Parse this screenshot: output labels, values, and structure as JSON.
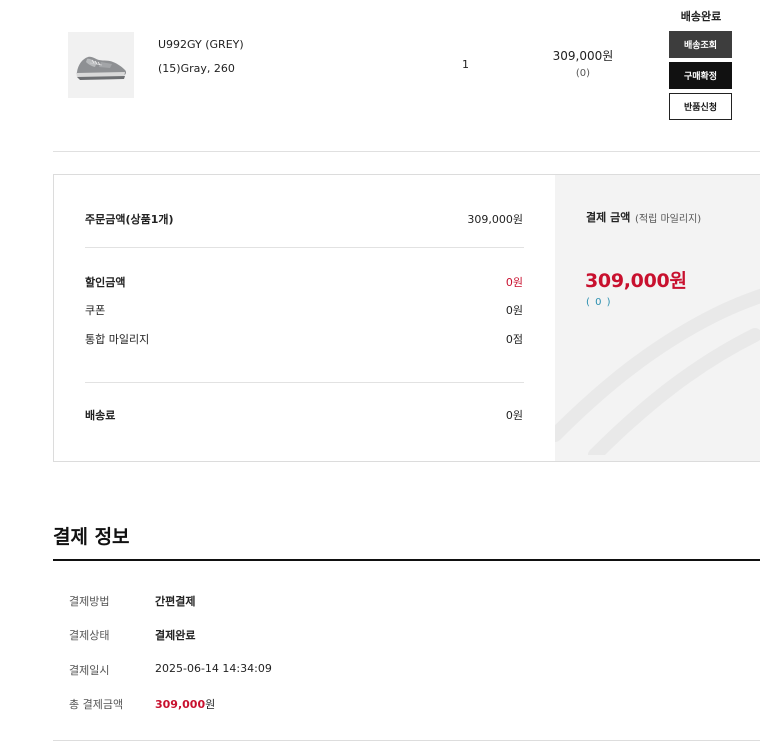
{
  "product": {
    "name": "U992GY (GREY)",
    "option": "(15)Gray, 260",
    "quantity": "1",
    "price": "309,000원",
    "point": "(0)",
    "image_icon": "sneaker-icon"
  },
  "shipping": {
    "status": "배송완료",
    "track_label": "배송조회",
    "confirm_label": "구매확정",
    "return_label": "반품신청"
  },
  "summary": {
    "order_amount_label": "주문금액(상품1개)",
    "order_amount_value": "309,000원",
    "discount_label": "할인금액",
    "discount_value": "0원",
    "coupon_label": "쿠폰",
    "coupon_value": "0원",
    "mileage_label": "통합 마일리지",
    "mileage_value": "0점",
    "delivery_label": "배송료",
    "delivery_value": "0원"
  },
  "payment_summary": {
    "title": "결제 금액",
    "subtitle": "(적립 마일리지)",
    "amount": "309,000원",
    "points": "( 0 )"
  },
  "payment_info": {
    "title": "결제 정보",
    "rows": [
      {
        "label": "결제방법",
        "value": "간편결제"
      },
      {
        "label": "결제상태",
        "value": "결제완료"
      },
      {
        "label": "결제일시",
        "value": "2025-06-14 14:34:09"
      },
      {
        "label": "총 결제금액",
        "value_amount": "309,000",
        "value_unit": "원"
      }
    ]
  },
  "colors": {
    "accent_red": "#c8102e",
    "point_blue": "#2a8fb0",
    "panel_gray": "#f3f3f3"
  }
}
